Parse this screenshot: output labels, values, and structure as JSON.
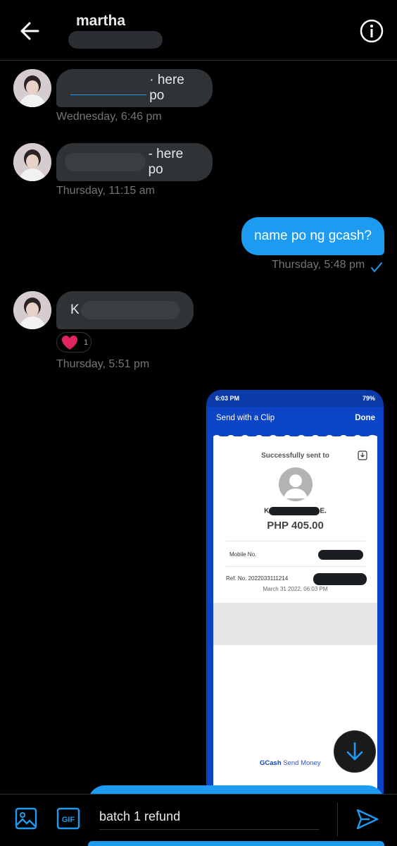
{
  "header": {
    "title": "martha"
  },
  "messages": [
    {
      "text": "· here po",
      "time": "Wednesday, 6:46 pm"
    },
    {
      "text": "- here po",
      "time": "Thursday, 11:15 am"
    },
    {
      "text": "name po ng gcash?",
      "time": "Thursday, 5:48 pm"
    },
    {
      "text": "K",
      "time": "Thursday, 5:51 pm",
      "reaction": {
        "emoji": "heart",
        "count": "1"
      }
    }
  ],
  "attachment": {
    "status_time": "6:03 PM",
    "status_battery": "79%",
    "bar_title": "Send with a Clip",
    "done_label": "Done",
    "sent_label": "Successfully sent to",
    "name_prefix": "K",
    "name_suffix": "E.",
    "amount": "PHP 405.00",
    "mobile_label": "Mobile No.",
    "ref_label": "Ref. No. 2022033111214",
    "date": "March 31 2022, 06:03 PM",
    "brand_strong": "GCash",
    "brand_rest": " Send Money"
  },
  "composer": {
    "value": "batch 1 refund"
  },
  "colors": {
    "accent": "#1d9bf0",
    "bubble_in": "#2f3336",
    "gcash_blue": "#0b44c4"
  }
}
